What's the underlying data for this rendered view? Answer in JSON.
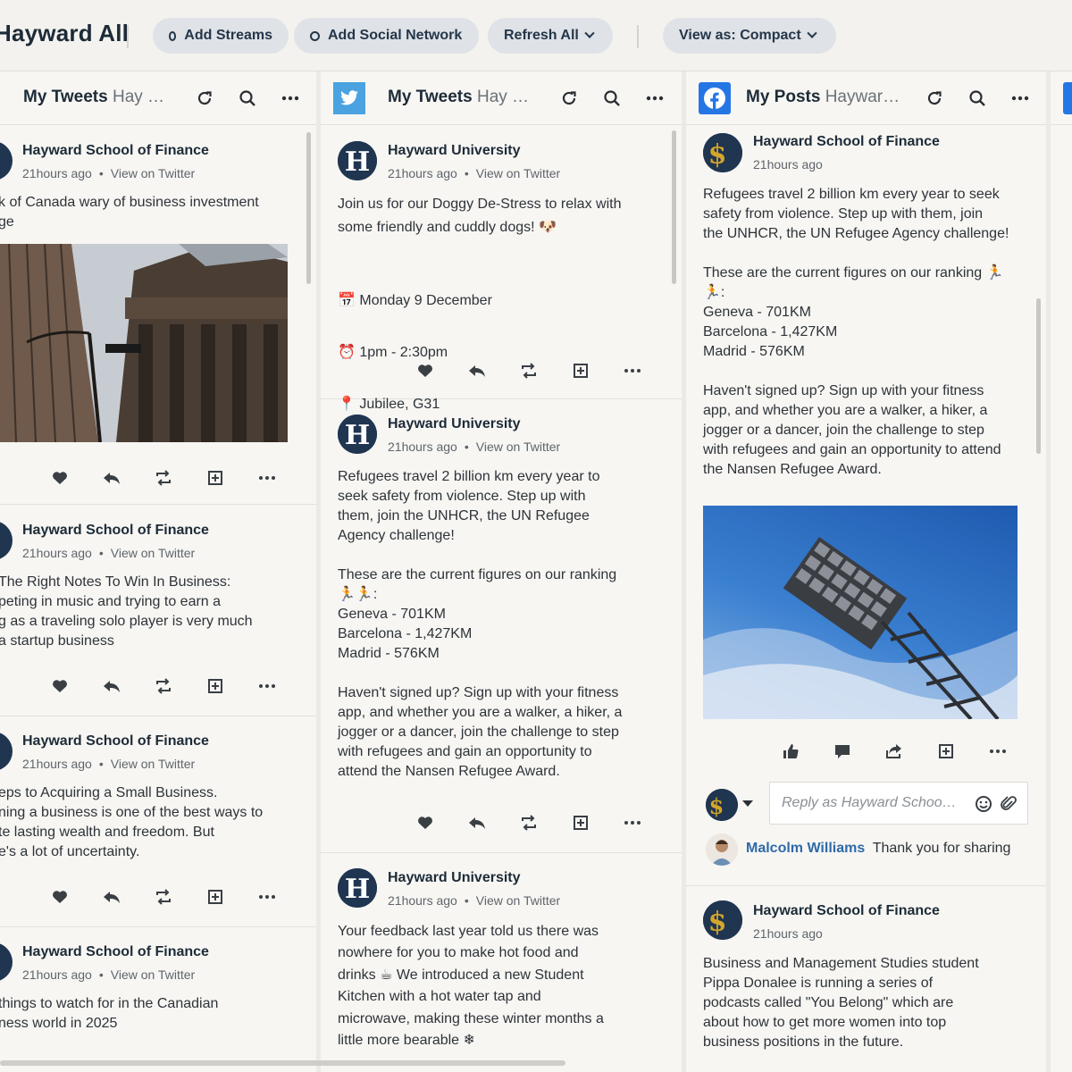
{
  "toolbar": {
    "title": "Hayward All",
    "add_streams": "Add Streams",
    "add_social": "Add Social Network",
    "refresh_all": "Refresh All",
    "view_as": "View as: Compact"
  },
  "col1": {
    "title": "My Tweets",
    "subtitle": "Hay …",
    "posts": [
      {
        "author": "Hayward School of Finance",
        "time": "21hours ago",
        "link": "View on Twitter",
        "text": "k of Canada wary of business investment\nge"
      },
      {
        "author": "Hayward School of Finance",
        "time": "21hours ago",
        "link": "View on Twitter",
        "text": "The Right Notes To Win In Business:\npeting in music and trying to earn a\ng as a traveling solo player is very much\na startup business"
      },
      {
        "author": "Hayward School of Finance",
        "time": "21hours ago",
        "link": "View on Twitter",
        "text": "eps to Acquiring a Small Business.\nning a business is one of the best ways to\nte lasting wealth and freedom. But\ne's a lot of uncertainty."
      },
      {
        "author": "Hayward School of Finance",
        "time": "21hours ago",
        "link": "View on Twitter",
        "text": "things to watch for in the Canadian\nness world in 2025"
      }
    ]
  },
  "col2": {
    "title": "My Tweets",
    "subtitle": "Hay …",
    "posts": [
      {
        "author": "Hayward University",
        "time": "21hours ago",
        "link": "View on Twitter",
        "text": "Join us for our Doggy De-Stress to relax with\nsome friendly and cuddly dogs! 🐶",
        "date": "Monday 9 December",
        "hours": "1pm - 2:30pm",
        "place": "Jubilee, G31"
      },
      {
        "author": "Hayward University",
        "time": "21hours ago",
        "link": "View on Twitter",
        "text": "Refugees travel 2 billion km every year to\nseek safety from violence. Step up with\nthem, join the UNHCR, the UN Refugee\nAgency challenge!\n\nThese are the current figures on our ranking\n🏃🏃:\nGeneva - 701KM\nBarcelona - 1,427KM\nMadrid - 576KM\n\nHaven't signed up? Sign up with your fitness\napp, and whether you are a walker, a hiker, a\njogger or a dancer, join the challenge to step\nwith refugees and gain an opportunity to\nattend the Nansen Refugee Award."
      },
      {
        "author": "Hayward University",
        "time": "21hours ago",
        "link": "View on Twitter",
        "text": "Your feedback last year told us there was\nnowhere for you to make hot food and\ndrinks ☕ We introduced a new Student\nKitchen with a hot water tap and\nmicrowave, making these winter months a\nlittle more bearable ❄"
      }
    ]
  },
  "col3": {
    "title": "My Posts",
    "subtitle": "Haywar…",
    "posts": [
      {
        "author": "Hayward School of Finance",
        "time": "21hours ago",
        "text": "Refugees travel 2 billion km every year to seek\nsafety from violence. Step up with them, join\nthe UNHCR, the UN Refugee Agency challenge!\n\nThese are the current figures on our ranking 🏃\n🏃:\nGeneva - 701KM\nBarcelona - 1,427KM\nMadrid - 576KM\n\nHaven't signed up? Sign up with your fitness\napp, and whether you are a walker, a hiker, a\njogger or a dancer, join the challenge to step\nwith refugees and gain an opportunity to attend\nthe Nansen Refugee Award."
      },
      {
        "author": "Hayward School of Finance",
        "time": "21hours ago",
        "text": "Business and Management Studies student\nPippa Donalee is running a series of\npodcasts called \"You Belong\" which are\nabout how to get more women into top\nbusiness positions in the future."
      }
    ],
    "reply_placeholder": "Reply as Hayward Schoo…",
    "comment_author": "Malcolm Williams",
    "comment_text": "Thank you for sharing"
  }
}
